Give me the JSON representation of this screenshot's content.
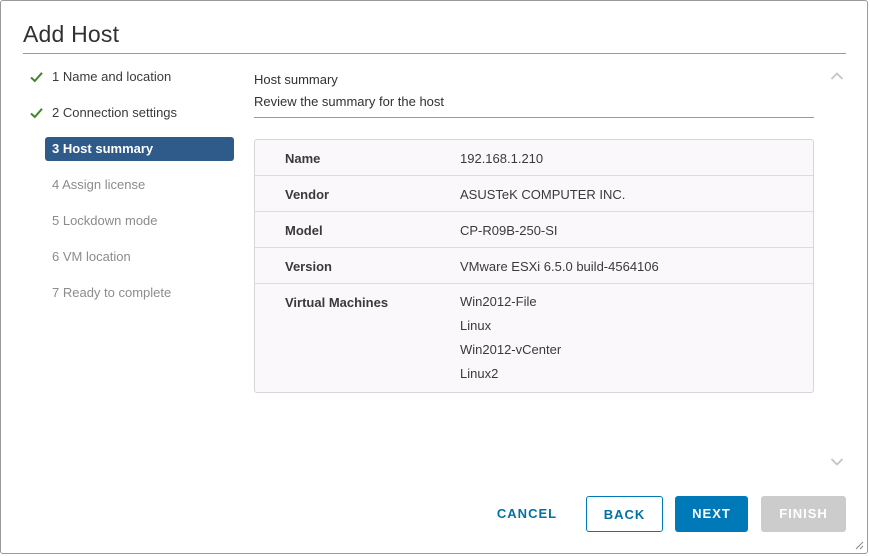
{
  "dialog": {
    "title": "Add Host"
  },
  "steps": [
    {
      "label": "1 Name and location",
      "state": "done"
    },
    {
      "label": "2 Connection settings",
      "state": "done"
    },
    {
      "label": "3 Host summary",
      "state": "active"
    },
    {
      "label": "4 Assign license",
      "state": "pending"
    },
    {
      "label": "5 Lockdown mode",
      "state": "pending"
    },
    {
      "label": "6 VM location",
      "state": "pending"
    },
    {
      "label": "7 Ready to complete",
      "state": "pending"
    }
  ],
  "content": {
    "title": "Host summary",
    "description": "Review the summary for the host"
  },
  "summary": {
    "name_label": "Name",
    "name_value": "192.168.1.210",
    "vendor_label": "Vendor",
    "vendor_value": "ASUSTeK COMPUTER INC.",
    "model_label": "Model",
    "model_value": "CP-R09B-250-SI",
    "version_label": "Version",
    "version_value": "VMware ESXi 6.5.0 build-4564106",
    "vms_label": "Virtual Machines",
    "vms": [
      "Win2012-File",
      "Linux",
      "Win2012-vCenter",
      "Linux2"
    ]
  },
  "buttons": {
    "cancel": "CANCEL",
    "back": "BACK",
    "next": "NEXT",
    "finish": "FINISH"
  },
  "colors": {
    "accent": "#0079b8",
    "active_step": "#2e5b8a",
    "check": "#3c8a1f",
    "disabled_button": "#cccccc"
  },
  "icons": {
    "step_done": "check-icon",
    "scroll_up": "chevron-up-icon",
    "scroll_down": "chevron-down-icon"
  }
}
